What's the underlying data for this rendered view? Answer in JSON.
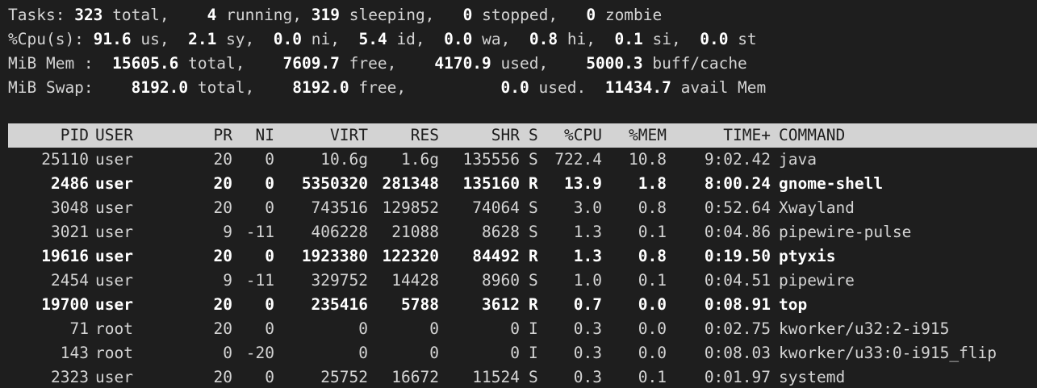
{
  "summary": {
    "tasks": {
      "label": "Tasks:",
      "total": "323",
      "total_label": "total,",
      "running": "4",
      "running_label": "running,",
      "sleeping": "319",
      "sleeping_label": "sleeping,",
      "stopped": "0",
      "stopped_label": "stopped,",
      "zombie": "0",
      "zombie_label": "zombie"
    },
    "cpu": {
      "label": "%Cpu(s):",
      "us": "91.6",
      "sy": "2.1",
      "ni": "0.0",
      "id": "5.4",
      "wa": "0.0",
      "hi": "0.8",
      "si": "0.1",
      "st": "0.0"
    },
    "mem": {
      "label": "MiB Mem :",
      "total": "15605.6",
      "free": "7609.7",
      "used": "4170.9",
      "buff": "5000.3"
    },
    "swap": {
      "label": "MiB Swap:",
      "total": "8192.0",
      "free": "8192.0",
      "used": "0.0",
      "avail": "11434.7"
    }
  },
  "columns": [
    "PID",
    "USER",
    "PR",
    "NI",
    "VIRT",
    "RES",
    "SHR",
    "S",
    "%CPU",
    "%MEM",
    "TIME+",
    "COMMAND"
  ],
  "processes": [
    {
      "pid": "25110",
      "user": "user",
      "pr": "20",
      "ni": "0",
      "virt": "10.6g",
      "res": "1.6g",
      "shr": "135556",
      "s": "S",
      "cpu": "722.4",
      "mem": "10.8",
      "time": "9:02.42",
      "cmd": "java",
      "bold": false
    },
    {
      "pid": "2486",
      "user": "user",
      "pr": "20",
      "ni": "0",
      "virt": "5350320",
      "res": "281348",
      "shr": "135160",
      "s": "R",
      "cpu": "13.9",
      "mem": "1.8",
      "time": "8:00.24",
      "cmd": "gnome-shell",
      "bold": true
    },
    {
      "pid": "3048",
      "user": "user",
      "pr": "20",
      "ni": "0",
      "virt": "743516",
      "res": "129852",
      "shr": "74064",
      "s": "S",
      "cpu": "3.0",
      "mem": "0.8",
      "time": "0:52.64",
      "cmd": "Xwayland",
      "bold": false
    },
    {
      "pid": "3021",
      "user": "user",
      "pr": "9",
      "ni": "-11",
      "virt": "406228",
      "res": "21088",
      "shr": "8628",
      "s": "S",
      "cpu": "1.3",
      "mem": "0.1",
      "time": "0:04.86",
      "cmd": "pipewire-pulse",
      "bold": false
    },
    {
      "pid": "19616",
      "user": "user",
      "pr": "20",
      "ni": "0",
      "virt": "1923380",
      "res": "122320",
      "shr": "84492",
      "s": "R",
      "cpu": "1.3",
      "mem": "0.8",
      "time": "0:19.50",
      "cmd": "ptyxis",
      "bold": true
    },
    {
      "pid": "2454",
      "user": "user",
      "pr": "9",
      "ni": "-11",
      "virt": "329752",
      "res": "14428",
      "shr": "8960",
      "s": "S",
      "cpu": "1.0",
      "mem": "0.1",
      "time": "0:04.51",
      "cmd": "pipewire",
      "bold": false
    },
    {
      "pid": "19700",
      "user": "user",
      "pr": "20",
      "ni": "0",
      "virt": "235416",
      "res": "5788",
      "shr": "3612",
      "s": "R",
      "cpu": "0.7",
      "mem": "0.0",
      "time": "0:08.91",
      "cmd": "top",
      "bold": true
    },
    {
      "pid": "71",
      "user": "root",
      "pr": "20",
      "ni": "0",
      "virt": "0",
      "res": "0",
      "shr": "0",
      "s": "I",
      "cpu": "0.3",
      "mem": "0.0",
      "time": "0:02.75",
      "cmd": "kworker/u32:2-i915",
      "bold": false
    },
    {
      "pid": "143",
      "user": "root",
      "pr": "0",
      "ni": "-20",
      "virt": "0",
      "res": "0",
      "shr": "0",
      "s": "I",
      "cpu": "0.3",
      "mem": "0.0",
      "time": "0:08.03",
      "cmd": "kworker/u33:0-i915_flip",
      "bold": false
    },
    {
      "pid": "2323",
      "user": "user",
      "pr": "20",
      "ni": "0",
      "virt": "25752",
      "res": "16672",
      "shr": "11524",
      "s": "S",
      "cpu": "0.3",
      "mem": "0.1",
      "time": "0:01.97",
      "cmd": "systemd",
      "bold": false
    }
  ],
  "colors": {
    "background": "#1e1e1e",
    "text": "#d4d4d4",
    "bold": "#ffffff",
    "header_bg": "#d3d3d3"
  }
}
